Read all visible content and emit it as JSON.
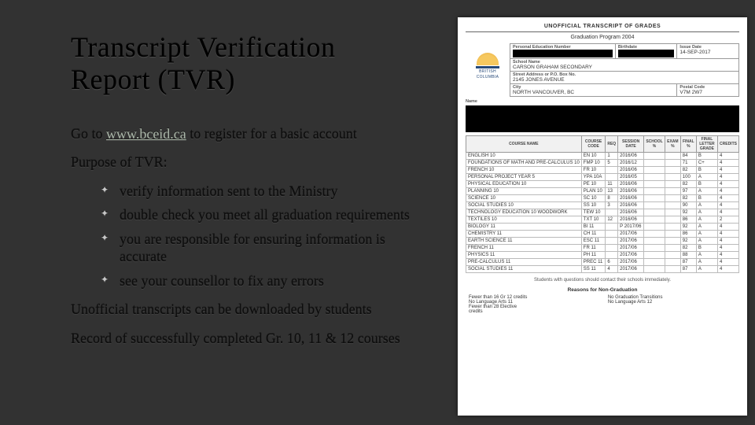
{
  "slide": {
    "title_line1": "Transcript Verification",
    "title_line2": "Report (TVR)",
    "intro_pre": "Go to ",
    "link_text": "www.bceid.ca",
    "intro_post": " to register for a basic account",
    "purpose_heading": "Purpose of TVR:",
    "bullets": [
      "verify information sent to the Ministry",
      "double check you meet all graduation requirements",
      "you are responsible for ensuring information is accurate",
      "see your counsellor to fix any errors"
    ],
    "para1": "Unofficial transcripts can be downloaded by students",
    "para2": "Record of successfully completed Gr. 10, 11 & 12 courses"
  },
  "transcript": {
    "title": "UNOFFICIAL TRANSCRIPT OF GRADES",
    "program": "Graduation Program 2004",
    "logo_line1": "BRITISH",
    "logo_line2": "COLUMBIA",
    "labels": {
      "pen": "Personal Education Number",
      "birth": "Birthdate",
      "issue": "Issue Date",
      "issue_val": "14-SEP-2017",
      "school": "School Name",
      "school_val": "CARSON GRAHAM SECONDARY",
      "addr": "Street Address or P.O. Box No.",
      "addr_val": "2145 JONES AVENUE",
      "city": "City",
      "city_val": "NORTH VANCOUVER, BC",
      "postal": "Postal Code",
      "postal_val": "V7M 2W7",
      "name": "Name"
    },
    "columns": [
      "COURSE NAME",
      "COURSE CODE",
      "REQ",
      "SESSION DATE",
      "SCHOOL %",
      "EXAM %",
      "FINAL %",
      "FINAL LETTER GRADE",
      "CREDITS"
    ],
    "rows": [
      [
        "ENGLISH 10",
        "EN 10",
        "1",
        "2016/06",
        "",
        "",
        "84",
        "B",
        "4"
      ],
      [
        "FOUNDATIONS OF MATH AND PRE-CALCULUS 10",
        "FMP 10",
        "5",
        "2016/12",
        "",
        "",
        "71",
        "C+",
        "4"
      ],
      [
        "FRENCH 10",
        "FR 10",
        "",
        "2016/06",
        "",
        "",
        "82",
        "B",
        "4"
      ],
      [
        "PERSONAL PROJECT YEAR 5",
        "YPA 10A",
        "",
        "2016/05",
        "",
        "",
        "100",
        "A",
        "4"
      ],
      [
        "PHYSICAL EDUCATION 10",
        "PE 10",
        "11",
        "2016/06",
        "",
        "",
        "82",
        "B",
        "4"
      ],
      [
        "PLANNING 10",
        "PLAN 10",
        "13",
        "2016/06",
        "",
        "",
        "97",
        "A",
        "4"
      ],
      [
        "SCIENCE 10",
        "SC 10",
        "8",
        "2016/06",
        "",
        "",
        "82",
        "B",
        "4"
      ],
      [
        "SOCIAL STUDIES 10",
        "SS 10",
        "3",
        "2016/06",
        "",
        "",
        "90",
        "A",
        "4"
      ],
      [
        "TECHNOLOGY EDUCATION 10 WOODWORK",
        "TEW 10",
        "",
        "2016/06",
        "",
        "",
        "92",
        "A",
        "4"
      ],
      [
        "TEXTILES 10",
        "TXT 10",
        "12",
        "2016/06",
        "",
        "",
        "86",
        "A",
        "2"
      ],
      [
        "BIOLOGY 11",
        "BI 11",
        "",
        "P 2017/06",
        "",
        "",
        "92",
        "A",
        "4"
      ],
      [
        "CHEMISTRY 11",
        "CH 11",
        "",
        "2017/06",
        "",
        "",
        "86",
        "A",
        "4"
      ],
      [
        "EARTH SCIENCE 11",
        "ESC 11",
        "",
        "2017/06",
        "",
        "",
        "92",
        "A",
        "4"
      ],
      [
        "FRENCH 11",
        "FR 11",
        "",
        "2017/06",
        "",
        "",
        "82",
        "B",
        "4"
      ],
      [
        "PHYSICS 11",
        "PH 11",
        "",
        "2017/06",
        "",
        "",
        "88",
        "A",
        "4"
      ],
      [
        "PRE-CALCULUS 11",
        "PREC 11",
        "6",
        "2017/06",
        "",
        "",
        "87",
        "A",
        "4"
      ],
      [
        "SOCIAL STUDIES 11",
        "SS 11",
        "4",
        "2017/06",
        "",
        "",
        "87",
        "A",
        "4"
      ]
    ],
    "note": "Students with questions should contact their schools immediately.",
    "reasons_h": "Reasons for Non-Graduation",
    "reasons_left": [
      "Fewer than 16 Gr 12 credits",
      "No Language Arts 11",
      "Fewer than 28 Elective credits"
    ],
    "reasons_right": [
      "No Graduation Transitions",
      "No Language Arts 12"
    ]
  }
}
